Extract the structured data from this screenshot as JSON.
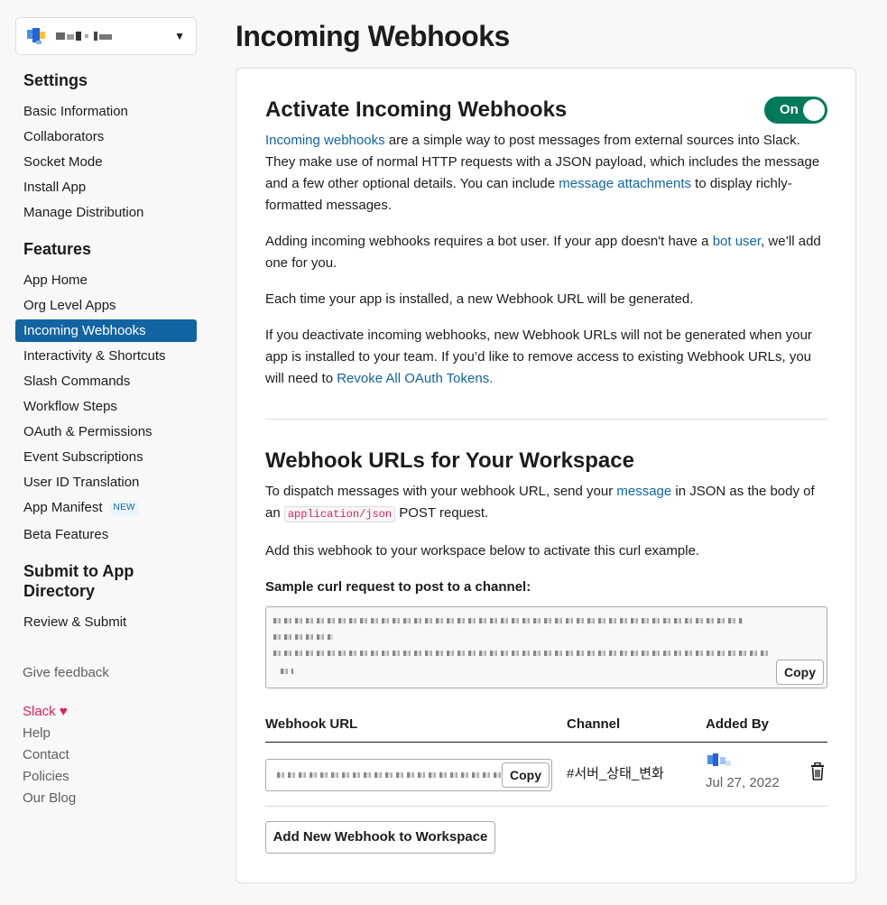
{
  "sidebar": {
    "app_switcher": {
      "icon": "app-icon",
      "caret": "▼"
    },
    "settings_heading": "Settings",
    "settings_items": [
      {
        "label": "Basic Information"
      },
      {
        "label": "Collaborators"
      },
      {
        "label": "Socket Mode"
      },
      {
        "label": "Install App"
      },
      {
        "label": "Manage Distribution"
      }
    ],
    "features_heading": "Features",
    "features_items": [
      {
        "label": "App Home"
      },
      {
        "label": "Org Level Apps"
      },
      {
        "label": "Incoming Webhooks",
        "active": true
      },
      {
        "label": "Interactivity & Shortcuts"
      },
      {
        "label": "Slash Commands"
      },
      {
        "label": "Workflow Steps"
      },
      {
        "label": "OAuth & Permissions"
      },
      {
        "label": "Event Subscriptions"
      },
      {
        "label": "User ID Translation"
      },
      {
        "label": "App Manifest",
        "badge": "NEW"
      },
      {
        "label": "Beta Features"
      }
    ],
    "submit_heading": "Submit to App Directory",
    "submit_items": [
      {
        "label": "Review & Submit"
      }
    ],
    "give_feedback": "Give feedback",
    "footer": {
      "slack": "Slack",
      "heart": "♥",
      "help": "Help",
      "contact": "Contact",
      "policies": "Policies",
      "blog": "Our Blog"
    }
  },
  "main": {
    "page_title": "Incoming Webhooks",
    "activate": {
      "title": "Activate Incoming Webhooks",
      "toggle_label": "On",
      "toggle_state": "on",
      "p1_link1": "Incoming webhooks",
      "p1_text1": " are a simple way to post messages from external sources into Slack. They make use of normal HTTP requests with a JSON payload, which includes the message and a few other optional details. You can include ",
      "p1_link2": "message attachments",
      "p1_text2": " to display richly-formatted messages.",
      "p2_text1": "Adding incoming webhooks requires a bot user. If your app doesn't have a ",
      "p2_link": "bot user",
      "p2_text2": ", we’ll add one for you.",
      "p3": "Each time your app is installed, a new Webhook URL will be generated.",
      "p4_text": "If you deactivate incoming webhooks, new Webhook URLs will not be generated when your app is installed to your team. If you’d like to remove access to existing Webhook URLs, you will need to ",
      "p4_link": "Revoke All OAuth Tokens."
    },
    "workspace": {
      "title": "Webhook URLs for Your Workspace",
      "p1_text1": "To dispatch messages with your webhook URL, send your ",
      "p1_link": "message",
      "p1_text2": " in JSON as the body of an ",
      "p1_code": "application/json",
      "p1_text3": " POST request.",
      "p2": "Add this webhook to your workspace below to activate this curl example.",
      "curl_label": "Sample curl request to post to a channel:",
      "copy_label": "Copy",
      "table": {
        "headers": [
          "Webhook URL",
          "Channel",
          "Added By"
        ],
        "rows": [
          {
            "copy_label": "Copy",
            "channel": "#서버_상태_변화",
            "added_date": "Jul 27, 2022"
          }
        ]
      },
      "add_button": "Add New Webhook to Workspace"
    }
  },
  "colors": {
    "accent": "#1264a3",
    "toggle_on": "#007a5a",
    "slack_pink": "#e01e5a"
  }
}
